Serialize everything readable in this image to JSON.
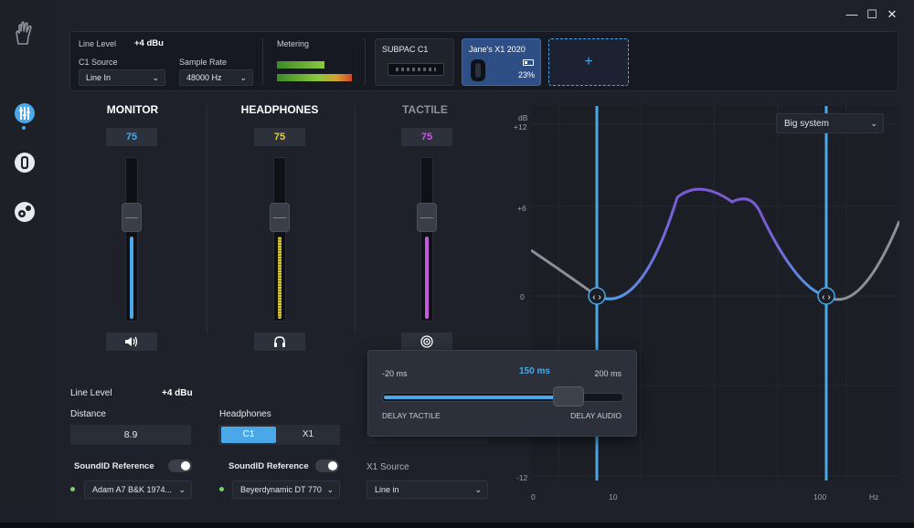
{
  "window": {
    "minimize_label": "—",
    "maximize_label": "☐",
    "close_label": "✕"
  },
  "sidebar": {
    "items": [
      {
        "name": "hand-logo-icon"
      },
      {
        "name": "mixer-icon",
        "active": true
      },
      {
        "name": "device-icon"
      },
      {
        "name": "soundid-icon"
      }
    ]
  },
  "top": {
    "line_level_label": "Line Level",
    "line_level_value": "+4 dBu",
    "c1_source_label": "C1 Source",
    "c1_source_value": "Line In",
    "sample_rate_label": "Sample Rate",
    "sample_rate_value": "48000 Hz",
    "metering_label": "Metering",
    "devices": [
      {
        "name": "SUBPAC C1"
      },
      {
        "name": "Jane's X1 2020",
        "battery": "23%"
      }
    ],
    "add_label": "+"
  },
  "channels": {
    "monitor": {
      "title": "MONITOR",
      "value": "75",
      "color": "#4aa8e8"
    },
    "headphones": {
      "title": "HEADPHONES",
      "value": "75",
      "color": "#e3d24a"
    },
    "tactile": {
      "title": "TACTILE",
      "value": "75",
      "color": "#c55ce0"
    }
  },
  "monitor_settings": {
    "line_level_label": "Line Level",
    "line_level_value": "+4 dBu",
    "distance_label": "Distance",
    "distance_value": "8.9",
    "soundid_label": "SoundID Reference",
    "reference_value": "Adam A7 B&K 1974..."
  },
  "headphone_settings": {
    "label": "Headphones",
    "options": [
      "C1",
      "X1"
    ],
    "selected": "C1",
    "soundid_label": "SoundID Reference",
    "reference_value": "Beyerdynamic DT 770"
  },
  "tactile_settings": {
    "x1_source_label": "X1 Source",
    "x1_source_value": "Line in"
  },
  "delay_popup": {
    "min_label": "-20 ms",
    "current_label": "150 ms",
    "max_label": "200 ms",
    "left_caption": "DELAY TACTILE",
    "right_caption": "DELAY AUDIO",
    "value": 150,
    "min": -20,
    "max": 200
  },
  "graph": {
    "preset_value": "Big system",
    "y_unit": "dB",
    "y_ticks": [
      "+12",
      "+6",
      "0",
      "-12"
    ],
    "x_ticks": [
      "0",
      "10",
      "100"
    ],
    "x_unit": "Hz",
    "line_color": "#4aa8e8",
    "curve_colors": [
      "#8b8f98",
      "#4aa8e8",
      "#7b5ad6"
    ]
  }
}
